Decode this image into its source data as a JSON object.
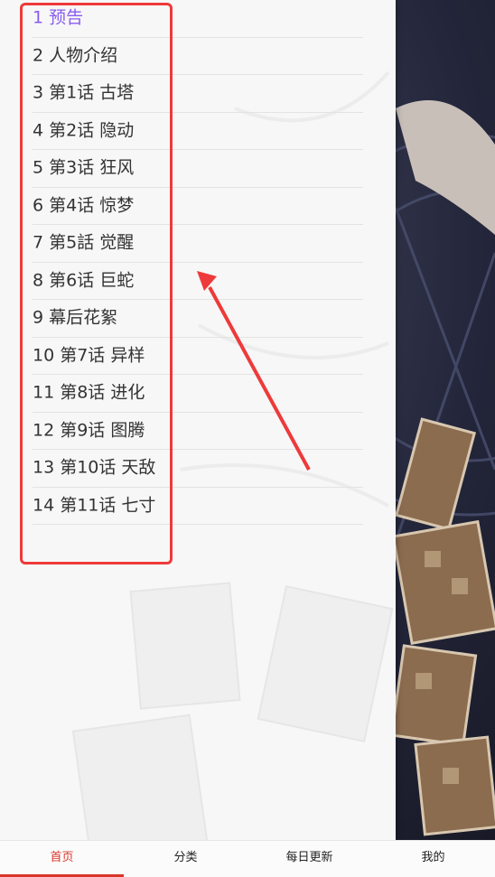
{
  "chapters": [
    {
      "label": "1 预告",
      "active": true
    },
    {
      "label": "2 人物介绍"
    },
    {
      "label": "3 第1话 古塔"
    },
    {
      "label": "4 第2话 隐动"
    },
    {
      "label": "5 第3话 狂风"
    },
    {
      "label": "6 第4话 惊梦"
    },
    {
      "label": "7 第5話 觉醒"
    },
    {
      "label": "8 第6话 巨蛇"
    },
    {
      "label": "9 幕后花絮"
    },
    {
      "label": "10 第7话 异样"
    },
    {
      "label": "11 第8话 进化"
    },
    {
      "label": "12 第9话 图腾"
    },
    {
      "label": "13 第10话 天敌"
    },
    {
      "label": "14 第11话 七寸"
    }
  ],
  "nav": {
    "items": [
      {
        "label": "首页",
        "active": true
      },
      {
        "label": "分类"
      },
      {
        "label": "每日更新"
      },
      {
        "label": "我的"
      }
    ]
  },
  "colors": {
    "active_chapter": "#8a5cf0",
    "annotation_red": "#ee3a3a",
    "nav_active": "#d9362a"
  }
}
